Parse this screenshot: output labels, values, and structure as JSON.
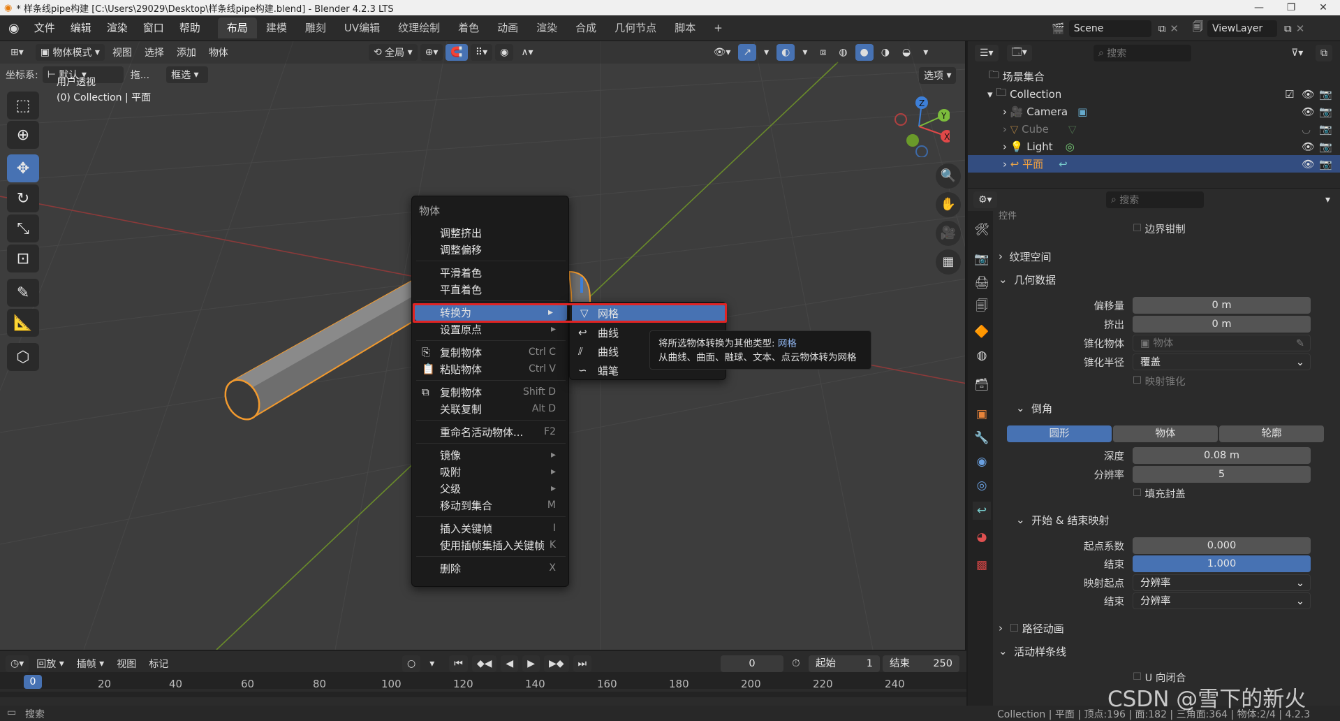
{
  "window": {
    "title": "* 样条线pipe构建 [C:\\Users\\29029\\Desktop\\样条线pipe构建.blend] - Blender 4.2.3 LTS",
    "minimize": "—",
    "maximize": "❐",
    "close": "✕"
  },
  "topbar": {
    "menus": [
      "文件",
      "编辑",
      "渲染",
      "窗口",
      "帮助"
    ],
    "workspaces": [
      "布局",
      "建模",
      "雕刻",
      "UV编辑",
      "纹理绘制",
      "着色",
      "动画",
      "渲染",
      "合成",
      "几何节点",
      "脚本"
    ],
    "active_workspace": "布局",
    "add_tab": "+",
    "scene": "Scene",
    "view_layer": "ViewLayer"
  },
  "viewport_header": {
    "mode": "物体模式",
    "menus": [
      "视图",
      "选择",
      "添加",
      "物体"
    ],
    "transform_orientation": "全局",
    "coord_label": "坐标系:",
    "coord_value": "默认",
    "drag_label": "拖...",
    "select_mode": "框选",
    "options": "选项"
  },
  "viewport": {
    "view_name": "用户透视",
    "collection_info": "(0) Collection | 平面"
  },
  "context_menu": {
    "title": "物体",
    "items": [
      {
        "label": "调整挤出",
        "shortcut": ""
      },
      {
        "label": "调整偏移",
        "shortcut": ""
      },
      {
        "label": "平滑着色",
        "shortcut": ""
      },
      {
        "label": "平直着色",
        "shortcut": ""
      },
      {
        "label": "转换为",
        "shortcut": "▸"
      },
      {
        "label": "设置原点",
        "shortcut": "▸"
      },
      {
        "label": "复制物体",
        "shortcut": "Ctrl C"
      },
      {
        "label": "粘贴物体",
        "shortcut": "Ctrl V"
      },
      {
        "label": "复制物体",
        "shortcut": "Shift D"
      },
      {
        "label": "关联复制",
        "shortcut": "Alt D"
      },
      {
        "label": "重命名活动物体...",
        "shortcut": "F2"
      },
      {
        "label": "镜像",
        "shortcut": "▸"
      },
      {
        "label": "吸附",
        "shortcut": "▸"
      },
      {
        "label": "父级",
        "shortcut": "▸"
      },
      {
        "label": "移动到集合",
        "shortcut": "M"
      },
      {
        "label": "插入关键帧",
        "shortcut": "I"
      },
      {
        "label": "使用插帧集插入关键帧",
        "shortcut": "K"
      },
      {
        "label": "删除",
        "shortcut": "X"
      }
    ]
  },
  "submenu": {
    "items": [
      "网格",
      "曲线",
      "曲线",
      "蜡笔"
    ]
  },
  "tooltip": {
    "line1_prefix": "将所选物体转换为其他类型:",
    "line1_value": "网格",
    "line2": "从曲线、曲面、融球、文本、点云物体转为网格"
  },
  "outliner": {
    "search_placeholder": "搜索",
    "scene_collection": "场景集合",
    "collection": "Collection",
    "objects": [
      {
        "name": "Camera",
        "dimmed": false
      },
      {
        "name": "Cube",
        "dimmed": true
      },
      {
        "name": "Light",
        "dimmed": false
      },
      {
        "name": "平面",
        "dimmed": false,
        "selected": true
      }
    ]
  },
  "properties": {
    "search_placeholder": "搜索",
    "top_partial": "控件",
    "edge_clamp": "边界钳制",
    "texture_space": "纹理空间",
    "geometry": {
      "title": "几何数据",
      "offset_label": "偏移量",
      "offset_value": "0 m",
      "extrude_label": "挤出",
      "extrude_value": "0 m",
      "taper_obj_label": "锥化物体",
      "taper_obj_placeholder": "物体",
      "taper_radius_label": "锥化半径",
      "taper_radius_value": "覆盖",
      "map_taper": "映射锥化"
    },
    "bevel": {
      "title": "倒角",
      "modes": [
        "圆形",
        "物体",
        "轮廓"
      ],
      "active_mode": "圆形",
      "depth_label": "深度",
      "depth_value": "0.08 m",
      "resolution_label": "分辨率",
      "resolution_value": "5",
      "fill_caps": "填充封盖"
    },
    "start_end": {
      "title": "开始 & 结束映射",
      "start_label": "起点系数",
      "start_value": "0.000",
      "end_label": "结束",
      "end_value": "1.000",
      "map_start_label": "映射起点",
      "map_start_value": "分辨率",
      "map_end_label": "结束",
      "map_end_value": "分辨率"
    },
    "path_animation": "路径动画",
    "active_spline": {
      "title": "活动样条线",
      "cyclic_u": "U 向闭合"
    }
  },
  "timeline": {
    "menus": [
      "回放",
      "插帧",
      "视图",
      "标记"
    ],
    "current_frame": "0",
    "start_label": "起始",
    "start_value": "1",
    "end_label": "结束",
    "end_value": "250",
    "ticks": [
      "0",
      "20",
      "40",
      "60",
      "80",
      "100",
      "120",
      "140",
      "160",
      "180",
      "200",
      "220",
      "240"
    ]
  },
  "statusbar": {
    "left": "搜索",
    "right": "Collection | 平面 | 顶点:196 | 面:182 | 三角面:364 | 物体:2/4 | 4.2.3",
    "watermark": "CSDN @雪下的新火"
  },
  "colors": {
    "accent": "#4772b3",
    "highlight_box": "#e02424",
    "selection_outline": "#f29a2e"
  }
}
